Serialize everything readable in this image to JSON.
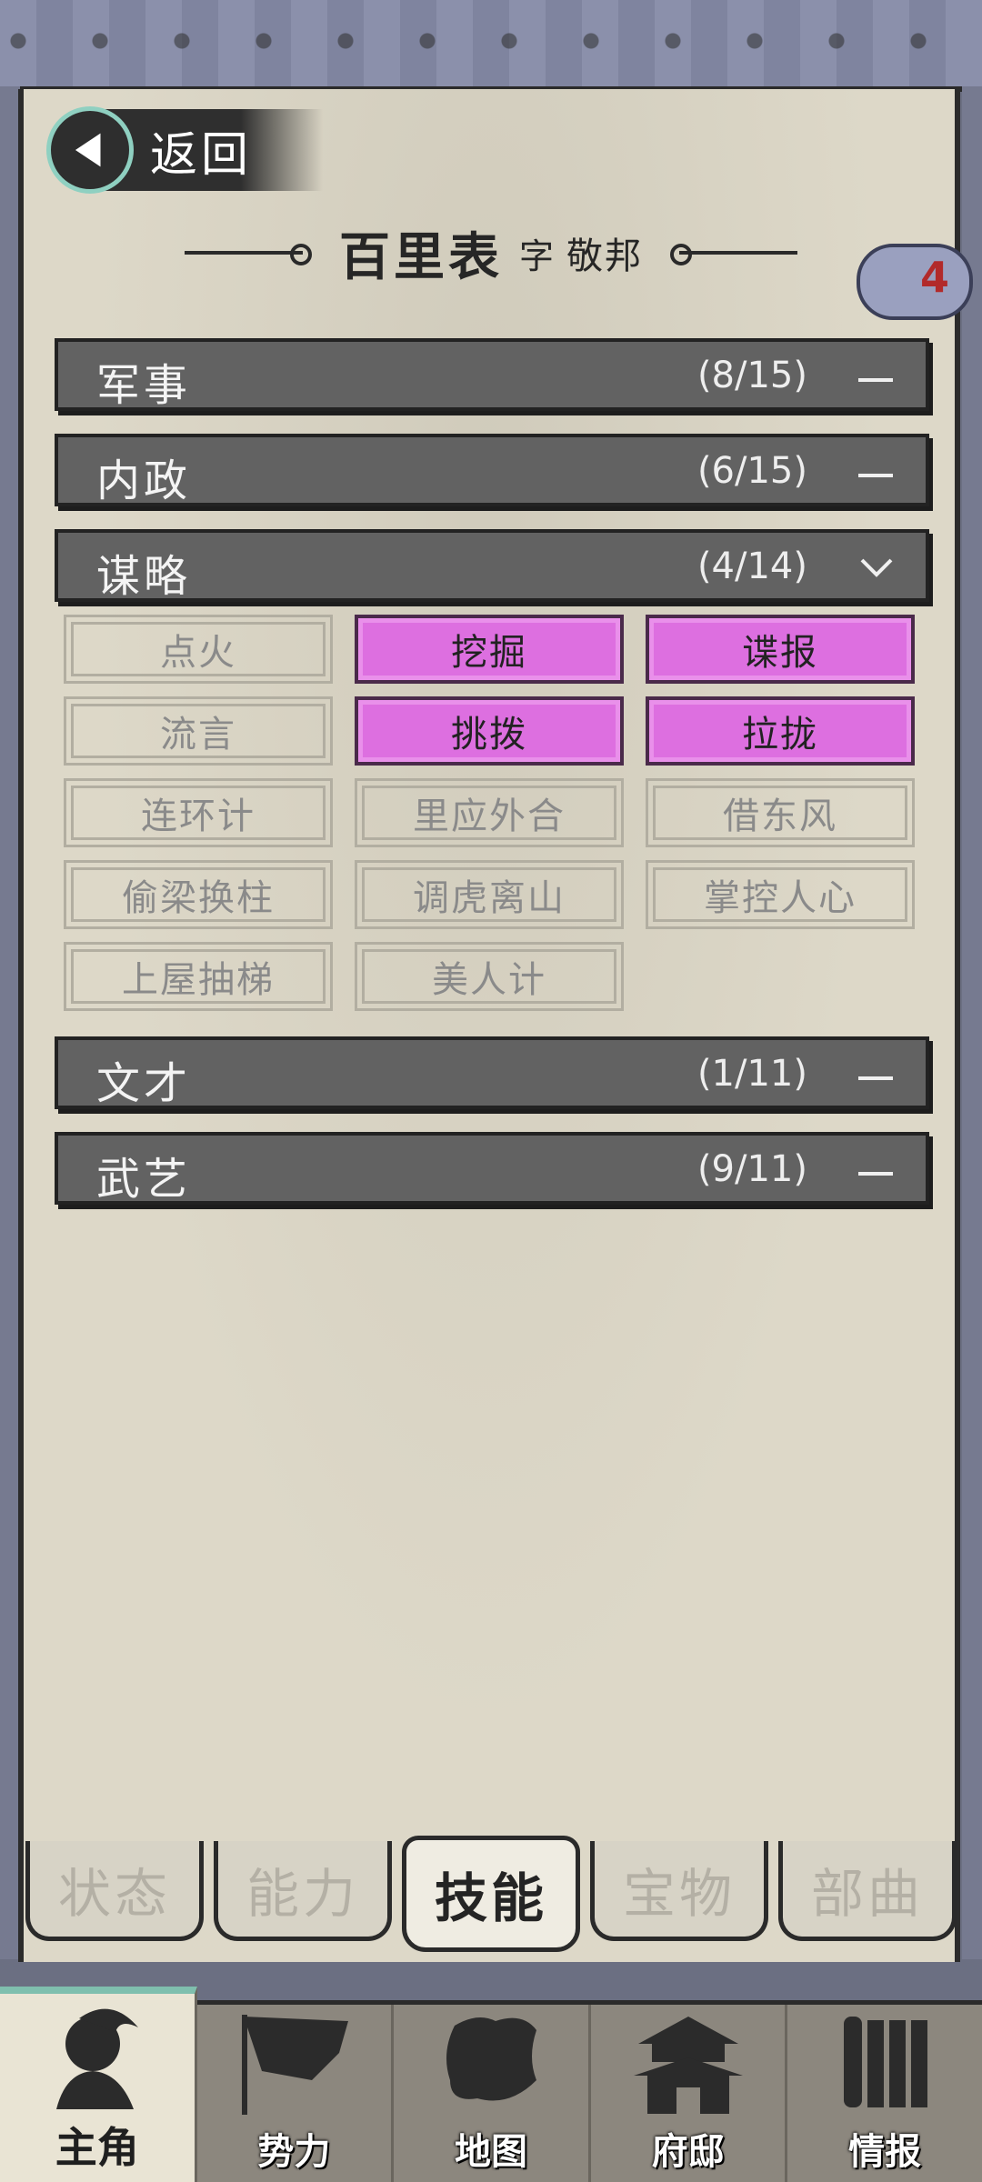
{
  "header": {
    "back_label": "返回",
    "name": "百里表",
    "zi_label": "字",
    "style_name": "敬邦",
    "badge_count": "4"
  },
  "categories": [
    {
      "name": "军事",
      "count": "(8/15)",
      "expanded": false
    },
    {
      "name": "内政",
      "count": "(6/15)",
      "expanded": false
    },
    {
      "name": "谋略",
      "count": "(4/14)",
      "expanded": true
    },
    {
      "name": "文才",
      "count": "(1/11)",
      "expanded": false
    },
    {
      "name": "武艺",
      "count": "(9/11)",
      "expanded": false
    }
  ],
  "skills": [
    {
      "name": "点火",
      "learned": false
    },
    {
      "name": "挖掘",
      "learned": true
    },
    {
      "name": "谍报",
      "learned": true
    },
    {
      "name": "流言",
      "learned": false
    },
    {
      "name": "挑拨",
      "learned": true
    },
    {
      "name": "拉拢",
      "learned": true
    },
    {
      "name": "连环计",
      "learned": false
    },
    {
      "name": "里应外合",
      "learned": false
    },
    {
      "name": "借东风",
      "learned": false
    },
    {
      "name": "偷梁换柱",
      "learned": false
    },
    {
      "name": "调虎离山",
      "learned": false
    },
    {
      "name": "掌控人心",
      "learned": false
    },
    {
      "name": "上屋抽梯",
      "learned": false
    },
    {
      "name": "美人计",
      "learned": false
    }
  ],
  "tabs": [
    {
      "label": "状态",
      "active": false
    },
    {
      "label": "能力",
      "active": false
    },
    {
      "label": "技能",
      "active": true
    },
    {
      "label": "宝物",
      "active": false
    },
    {
      "label": "部曲",
      "active": false
    }
  ],
  "nav": [
    {
      "label": "主角",
      "icon": "hero-icon",
      "active": true
    },
    {
      "label": "势力",
      "icon": "flag-icon",
      "active": false
    },
    {
      "label": "地图",
      "icon": "map-icon",
      "active": false
    },
    {
      "label": "府邸",
      "icon": "mansion-icon",
      "active": false
    },
    {
      "label": "情报",
      "icon": "scroll-icon",
      "active": false
    }
  ],
  "colors": {
    "skill_learned": "#dd6fe0",
    "category_bar": "#626262",
    "paper": "#ddd8c8",
    "badge_number": "#b22a2a"
  }
}
